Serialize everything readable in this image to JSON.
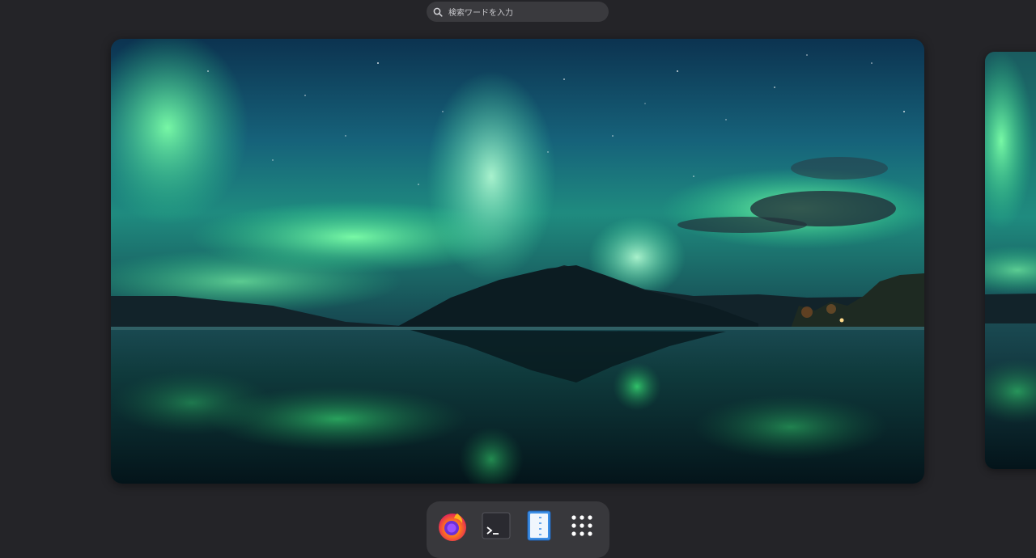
{
  "search": {
    "placeholder": "検索ワードを入力",
    "icon": "search-icon"
  },
  "workspaces": [
    {
      "name": "current-workspace",
      "wallpaper": "aurora-over-lake"
    },
    {
      "name": "next-workspace",
      "wallpaper": "aurora-over-lake"
    }
  ],
  "dock": {
    "items": [
      {
        "name": "firefox",
        "icon": "firefox-icon"
      },
      {
        "name": "terminal",
        "icon": "terminal-icon"
      },
      {
        "name": "text-editor",
        "icon": "text-editor-icon"
      },
      {
        "name": "show-apps",
        "icon": "app-grid-icon"
      }
    ]
  },
  "colors": {
    "background": "#242428",
    "search_bg": "#3a3a3e",
    "dock_bg": "#38383c",
    "aurora_green": "#4ef08a",
    "sky_dark": "#0d2a3e"
  }
}
